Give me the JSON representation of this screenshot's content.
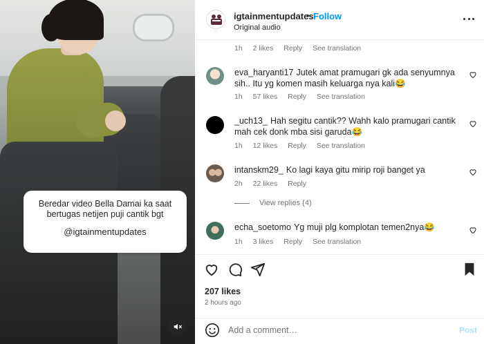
{
  "video": {
    "caption_line1": "Beredar video Bella Damai ka saat",
    "caption_line2": "bertugas netijen puji cantik bgt",
    "caption_handle": "@igtainmentupdates",
    "mute_icon": "speaker-muted-icon"
  },
  "header": {
    "username": "igtainmentupdates",
    "separator": "•",
    "follow_label": "Follow",
    "audio_label": "Original audio"
  },
  "colors": {
    "accent": "#0095f6",
    "text": "#262626",
    "muted": "#737373",
    "post_disabled": "#b2dffc"
  },
  "top_meta": {
    "time": "1h",
    "likes": "2 likes",
    "reply": "Reply",
    "translate": "See translation"
  },
  "comments": [
    {
      "username": "eva_haryanti17",
      "text": "Jutek amat pramugari gk ada senyumnya sih.. Itu yg komen masih keluarga nya kali😂",
      "time": "1h",
      "likes": "57 likes",
      "reply": "Reply",
      "translate": "See translation"
    },
    {
      "username": "_uch13_",
      "text": "Hah segitu cantik?? Wahh kalo pramugari cantik mah cek donk mba sisi garuda😂",
      "time": "1h",
      "likes": "12 likes",
      "reply": "Reply",
      "translate": "See translation"
    },
    {
      "username": "intanskm29_",
      "text": "Ko lagi kaya gitu mirip roji banget ya",
      "time": "2h",
      "likes": "22 likes",
      "reply": "Reply",
      "view_replies": "View replies (4)"
    },
    {
      "username": "echa_soetomo",
      "text": "Yg muji plg komplotan temen2nya😂",
      "time": "1h",
      "likes": "3 likes",
      "reply": "Reply",
      "translate": "See translation"
    }
  ],
  "actions": {
    "likes": "207 likes",
    "time_ago": "2 hours ago"
  },
  "add_comment": {
    "placeholder": "Add a comment…",
    "post_label": "Post"
  }
}
